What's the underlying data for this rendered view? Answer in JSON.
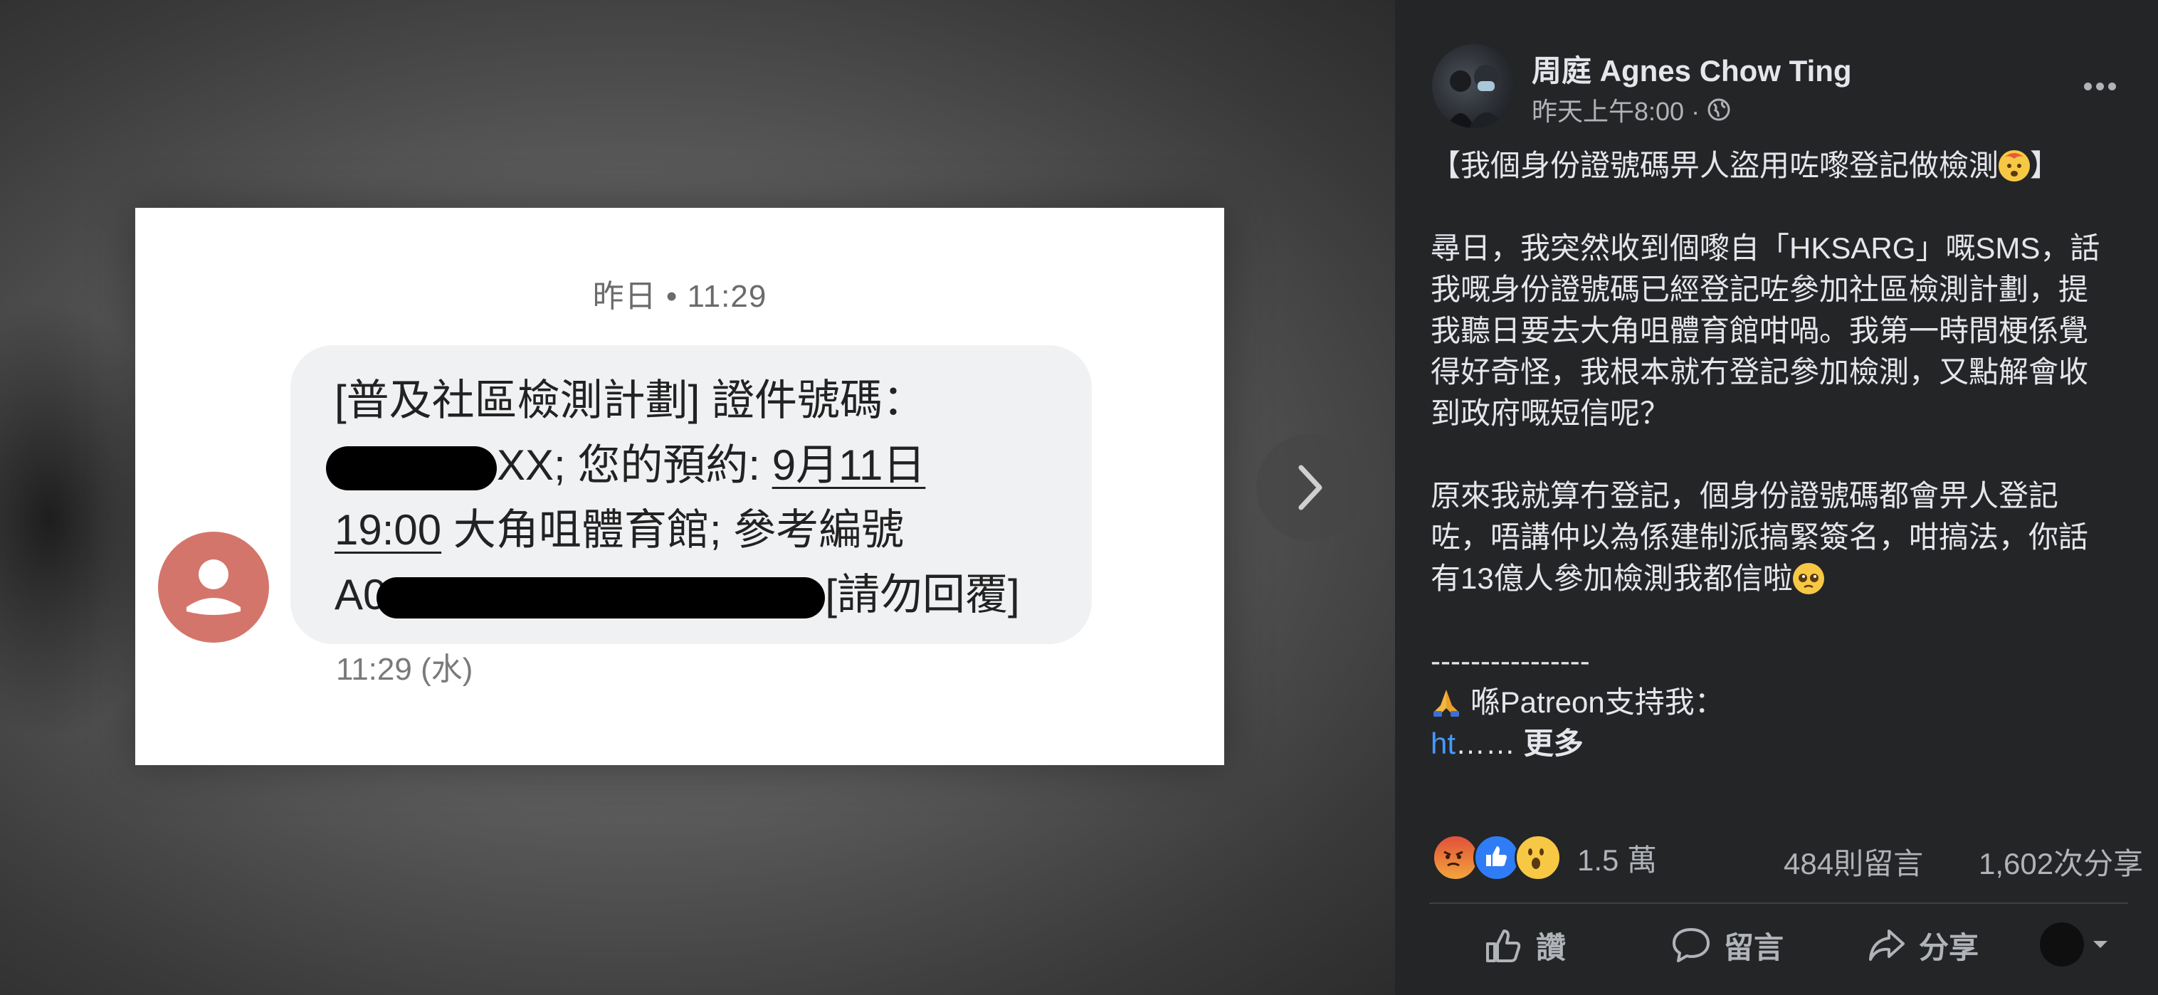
{
  "photo": {
    "sms_date": "昨日 • 11:29",
    "sms_line1": "[普及社區檢測計劃] 證件號碼：",
    "sms_line2_end": "XX; 您的預約: ",
    "sms_date_link": "9月11日",
    "sms_time_link": "19:00",
    "sms_line3_rest": " 大角咀體育館; 參考編號",
    "sms_line4_start": "A0",
    "sms_line4_end": "[請勿回覆]",
    "sms_time": "11:29 (水)"
  },
  "post": {
    "author": "周庭 Agnes Chow Ting",
    "timestamp": "昨天上午8:00 ·",
    "title_open": "【我個身份證號碼畀人盜用咗嚟登記做檢測",
    "title_close": "】",
    "para1": "尋日，我突然收到個嚟自「HKSARG」嘅SMS，話我嘅身份證號碼已經登記咗參加社區檢測計劃，提我聽日要去大角咀體育館咁喎。我第一時間梗係覺得好奇怪，我根本就冇登記參加檢測，又點解會收到政府嘅短信呢？",
    "para2": "原來我就算冇登記，個身份證號碼都會畀人登記咗，唔講仲以為係建制派搞緊簽名，咁搞法，你話有13億人參加檢測我都信啦",
    "separator": "----------------",
    "patreon": " 喺Patreon支持我：",
    "link_text": "ht",
    "ellipsis": "…… ",
    "see_more": "更多",
    "icons": {
      "title_emoji": "exploding-head-emoji",
      "para2_emoji": "pleading-face-emoji",
      "patreon_emoji": "folded-hands-emoji"
    }
  },
  "reactions": {
    "types": [
      "angry",
      "like",
      "wow"
    ],
    "count": "1.5 萬",
    "comments": "484則留言",
    "shares": "1,602次分享"
  },
  "actions": {
    "like": "讚",
    "comment": "留言",
    "share": "分享"
  },
  "colors": {
    "panel_bg": "#242527",
    "link": "#4599ff",
    "sms_avatar": "#d4756b"
  }
}
